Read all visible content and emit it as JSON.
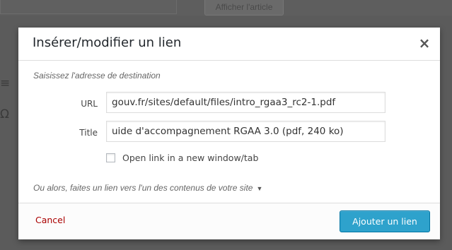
{
  "background": {
    "view_article_label": "Afficher l'article",
    "side_icons": [
      "≡",
      "Ω"
    ]
  },
  "dialog": {
    "title": "Insérer/modifier un lien",
    "close_glyph": "×",
    "hint": "Saisissez l'adresse de destination",
    "url": {
      "label": "URL",
      "value": "gouv.fr/sites/default/files/intro_rgaa3_rc2-1.pdf"
    },
    "title_field": {
      "label": "Title",
      "value": "uide d'accompagnement RGAA 3.0 (pdf, 240 ko)"
    },
    "new_tab": {
      "label": "Open link in a new window/tab",
      "checked": false
    },
    "internal_link_toggle": "Ou alors, faites un lien vers l'un des contenus de votre site",
    "caret_glyph": "▼",
    "cancel_label": "Cancel",
    "submit_label": "Ajouter un lien"
  },
  "colors": {
    "overlay": "#5f5f5f",
    "primary_button": "#2ea2cc",
    "cancel_link": "#aa0000"
  }
}
